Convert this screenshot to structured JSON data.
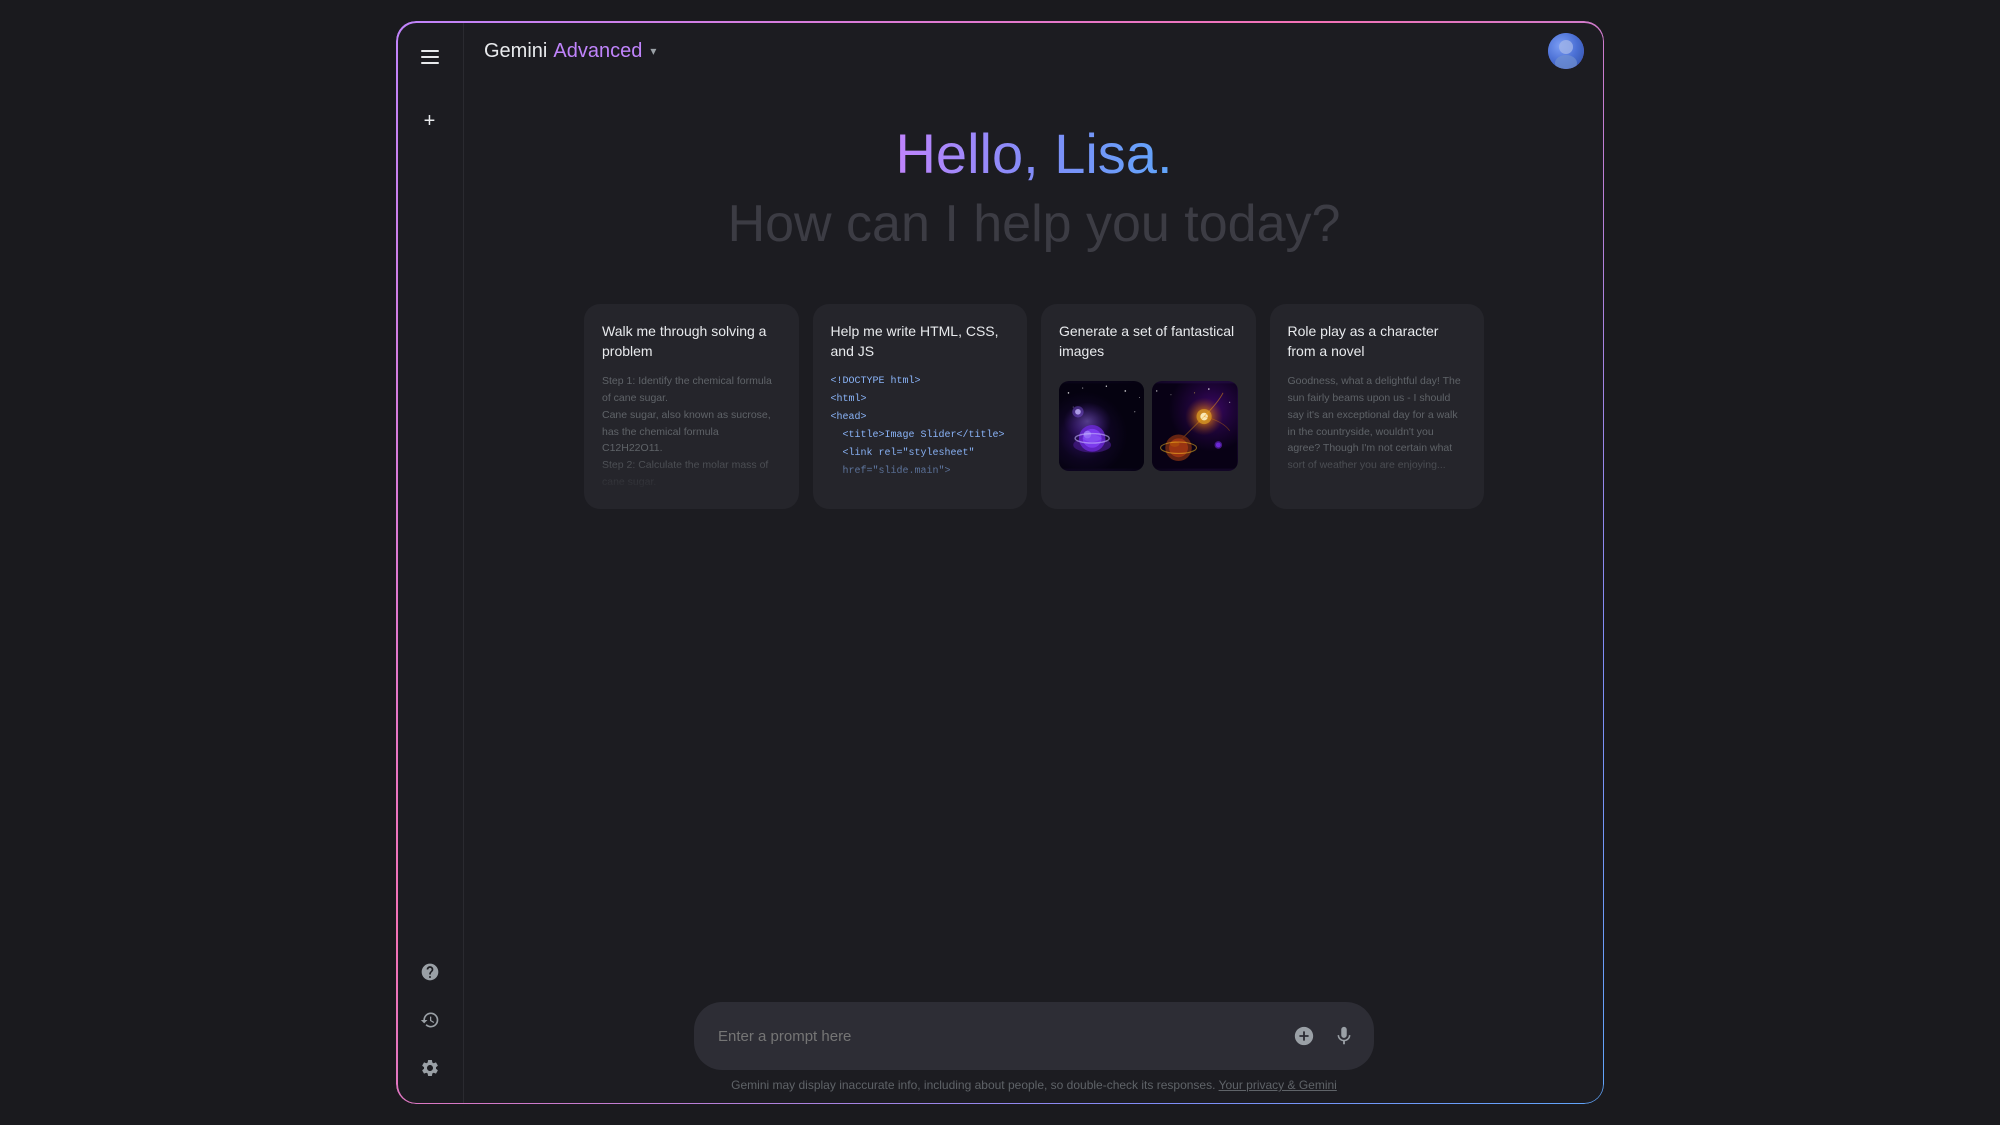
{
  "header": {
    "gemini_label": "Gemini",
    "advanced_label": "Advanced",
    "dropdown_symbol": "▾"
  },
  "greeting": {
    "hello": "Hello, Lisa.",
    "subtext": "How can I help you today?"
  },
  "cards": [
    {
      "id": "card-problem",
      "title": "Walk me through solving a problem",
      "preview_lines": [
        "Step 1: Identify the chemical formula",
        "of cane sugar.",
        "Cane sugar, also known as sucrose,",
        "has the chemical formula C12H22O11.",
        "Step 2: Calculate the molar mass of",
        "cane sugar."
      ]
    },
    {
      "id": "card-code",
      "title": "Help me write HTML, CSS, and JS",
      "preview_lines": [
        "<!DOCTYPE html>",
        "<html>",
        "<head>",
        "  <title>Image Slider</title>",
        "  <link rel=\"stylesheet\"",
        "  href=\"slide.main\">"
      ]
    },
    {
      "id": "card-images",
      "title": "Generate a set of fantastical images",
      "has_images": true
    },
    {
      "id": "card-roleplay",
      "title": "Role play as a character from a novel",
      "preview_lines": [
        "Goodness, what a delightful day! The",
        "sun fairly beams upon us - I should",
        "say it's an exceptional day for a walk",
        "in the countryside, wouldn't you",
        "agree? Though I'm not certain what",
        "sort of weather you are enjoying..."
      ]
    }
  ],
  "input": {
    "placeholder": "Enter a prompt here"
  },
  "disclaimer": {
    "text": "Gemini may display inaccurate info, including about people, so double-check its responses.",
    "link_text": "Your privacy & Gemini"
  },
  "sidebar": {
    "menu_label": "Menu",
    "new_chat_label": "New chat",
    "help_label": "Help",
    "history_label": "Activity",
    "settings_label": "Settings"
  },
  "colors": {
    "accent_purple": "#c084fc",
    "accent_blue": "#818cf8",
    "bg_card": "#25252b",
    "bg_main": "#1c1c21"
  }
}
